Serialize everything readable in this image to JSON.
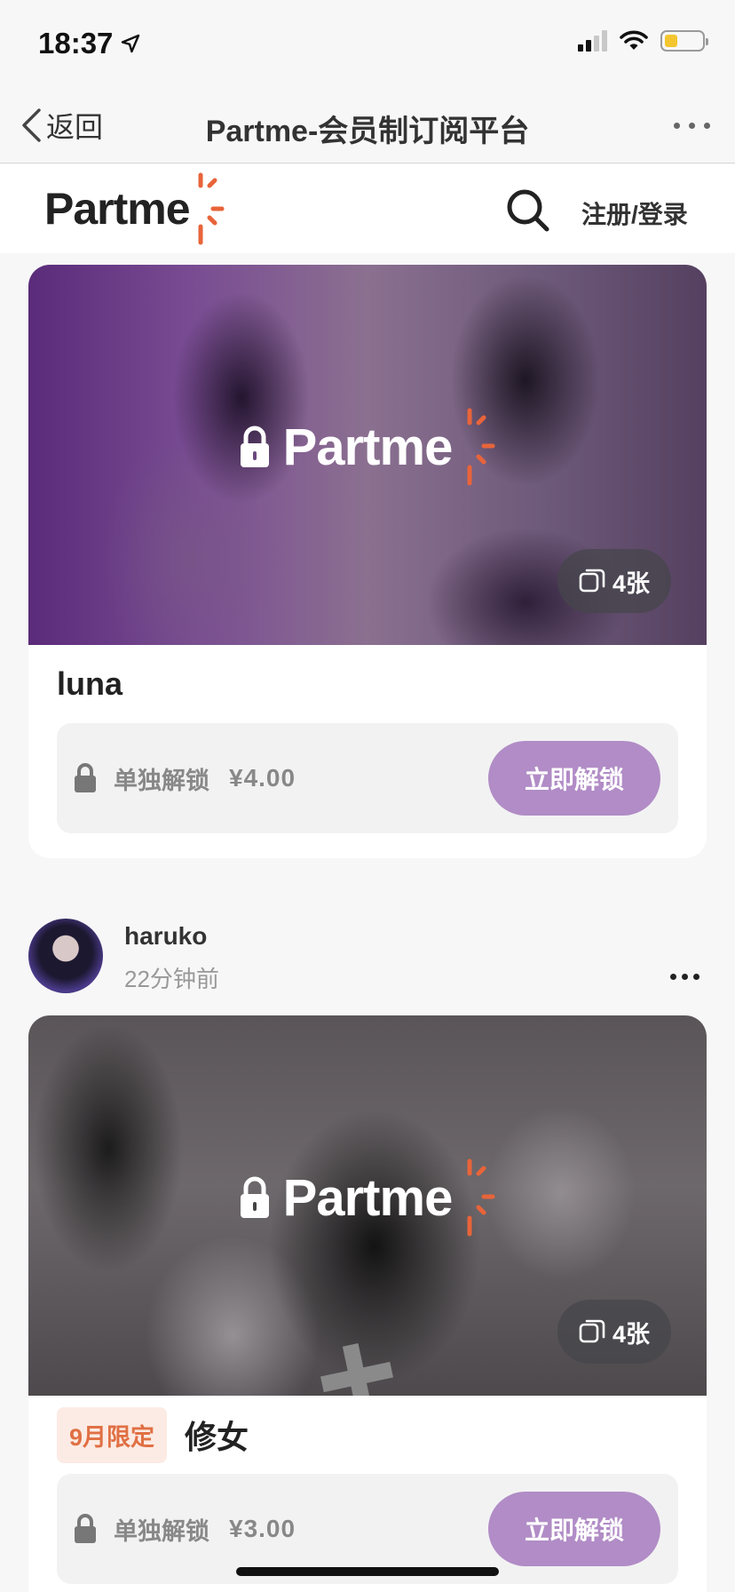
{
  "status": {
    "time": "18:37"
  },
  "nav": {
    "back_label": "返回",
    "title": "Partme-会员制订阅平台"
  },
  "header": {
    "logo_text": "Partme",
    "login_label": "注册/登录"
  },
  "colors": {
    "accent_orange": "#e8643a",
    "unlock_button": "#b18cc6",
    "tag_bg": "#fcebe4",
    "tag_text": "#e07044"
  },
  "posts": [
    {
      "watermark": "Partme",
      "count": "4张",
      "title": "luna",
      "unlock_label": "单独解锁",
      "price": "¥4.00",
      "button": "立即解锁"
    },
    {
      "author": {
        "name": "haruko",
        "time": "22分钟前"
      },
      "watermark": "Partme",
      "count": "4张",
      "tag": "9月限定",
      "title": "修女",
      "unlock_label": "单独解锁",
      "price": "¥3.00",
      "button": "立即解锁"
    }
  ]
}
